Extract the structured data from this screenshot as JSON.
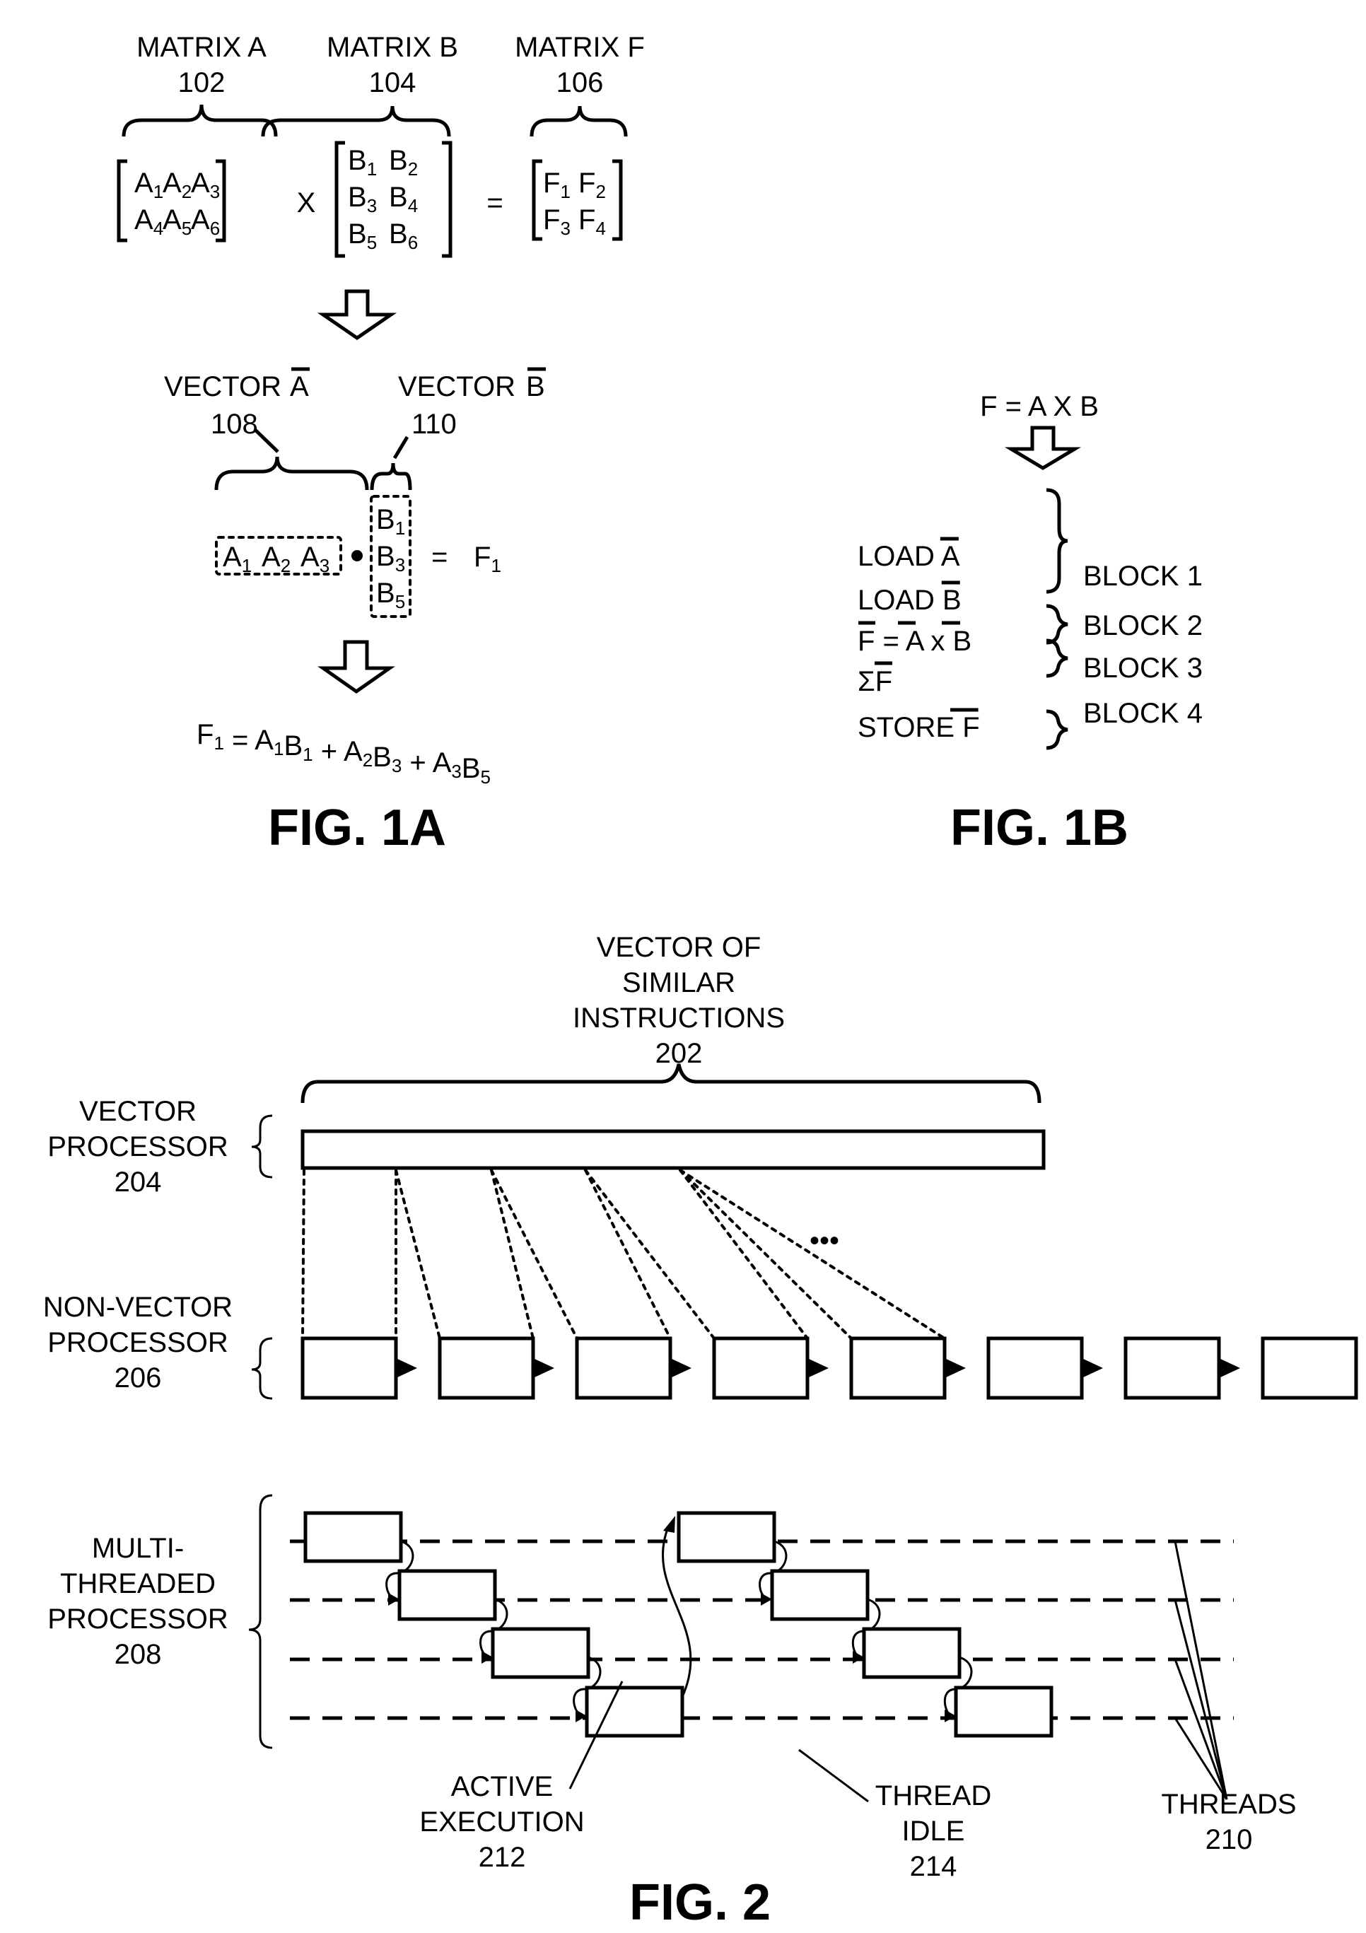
{
  "fig1a": {
    "caption": "FIG. 1A",
    "matrix_a": {
      "title": "MATRIX A",
      "ref": "102",
      "rows": [
        [
          "A",
          "1",
          "A",
          "2",
          "A",
          "3"
        ],
        [
          "A",
          "4",
          "A",
          "5",
          "A",
          "6"
        ]
      ]
    },
    "matrix_b": {
      "title": "MATRIX B",
      "ref": "104",
      "rows": [
        [
          "B",
          "1",
          "B",
          "2"
        ],
        [
          "B",
          "3",
          "B",
          "4"
        ],
        [
          "B",
          "5",
          "B",
          "6"
        ]
      ]
    },
    "matrix_f": {
      "title": "MATRIX F",
      "ref": "106",
      "rows": [
        [
          "F",
          "1",
          "F",
          "2"
        ],
        [
          "F",
          "3",
          "F",
          "4"
        ]
      ]
    },
    "times_symbol": "X",
    "equals_symbol": "=",
    "vector_a": {
      "title": "VECTOR",
      "bar_letter": "A",
      "ref": "108",
      "items": [
        [
          "A",
          "1"
        ],
        [
          "A",
          "2"
        ],
        [
          "A",
          "3"
        ]
      ]
    },
    "vector_b": {
      "title": "VECTOR",
      "bar_letter": "B",
      "ref": "110",
      "items": [
        [
          "B",
          "1"
        ],
        [
          "B",
          "3"
        ],
        [
          "B",
          "5"
        ]
      ]
    },
    "dot_result": [
      "F",
      "1"
    ],
    "formula": {
      "lhs": [
        "F",
        "1"
      ],
      "terms": [
        [
          [
            "A",
            "1"
          ],
          [
            "B",
            "1"
          ]
        ],
        [
          [
            "A",
            "2"
          ],
          [
            "B",
            "3"
          ]
        ],
        [
          [
            "A",
            "3"
          ],
          [
            "B",
            "5"
          ]
        ]
      ]
    }
  },
  "fig1b": {
    "caption": "FIG. 1B",
    "equation": "F = A X B",
    "instructions": [
      {
        "text": "LOAD",
        "bar": "A"
      },
      {
        "text": "LOAD",
        "bar": "B"
      },
      {
        "text": "F = A x B"
      },
      {
        "text": "ΣF"
      },
      {
        "text": "STORE",
        "bar": "F"
      }
    ],
    "blocks": [
      "BLOCK 1",
      "BLOCK 2",
      "BLOCK 3",
      "BLOCK 4"
    ]
  },
  "fig2": {
    "caption": "FIG. 2",
    "vector_instructions": {
      "lines": [
        "VECTOR OF",
        "SIMILAR",
        "INSTRUCTIONS",
        "202"
      ]
    },
    "vector_processor": {
      "lines": [
        "VECTOR",
        "PROCESSOR",
        "204"
      ]
    },
    "non_vector_processor": {
      "lines": [
        "NON-VECTOR",
        "PROCESSOR",
        "206"
      ],
      "box_count": 8
    },
    "ellipsis": "•••",
    "multithreaded_processor": {
      "lines": [
        "MULTI-",
        "THREADED",
        "PROCESSOR",
        "208"
      ],
      "thread_count": 4
    },
    "active_execution": {
      "lines": [
        "ACTIVE",
        "EXECUTION",
        "212"
      ]
    },
    "thread_idle": {
      "lines": [
        "THREAD",
        "IDLE",
        "214"
      ]
    },
    "threads": {
      "lines": [
        "THREADS",
        "210"
      ]
    }
  }
}
